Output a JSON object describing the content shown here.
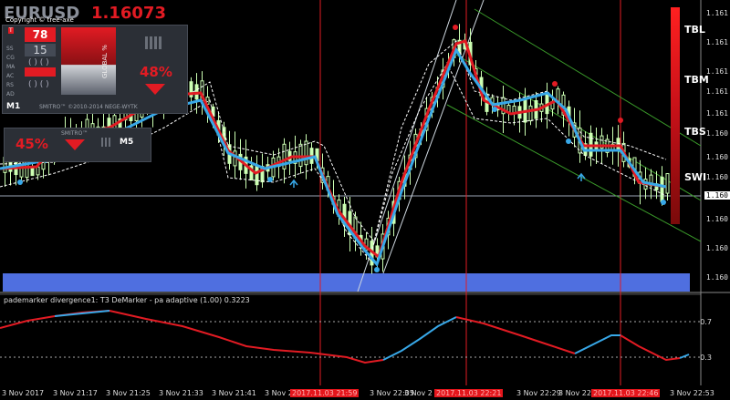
{
  "header": {
    "symbol": "EURUSD",
    "price": "1.16073",
    "copyright": "Copyright © tree-axe"
  },
  "panel": {
    "count": "78",
    "sub_count": "15",
    "timeframe_main": "M1",
    "timeframe_second": "M5",
    "pct_right": "48%",
    "pct_left": "45%",
    "global_label": "GLOBAL %",
    "credit": "SMITRO™ ©2010-2014 NEGE-WYTK",
    "side_labels": [
      "T",
      "SS",
      "CG",
      "MA",
      "AC",
      "RS",
      "AD"
    ]
  },
  "right_labels": [
    "TBL",
    "TBM",
    "TBS",
    "SWI"
  ],
  "price_axis": [
    "1.161",
    "1.161",
    "1.161",
    "1.161",
    "1.161",
    "1.160",
    "1.160",
    "1.160",
    "1.160",
    "1.160",
    "1.160"
  ],
  "price_current": "1.160",
  "indicator": {
    "title": "pademarker divergence1: T3 DeMarker - pa adaptive (1.00) 0.3223",
    "levels": [
      "0.7",
      "0.3"
    ]
  },
  "time_axis": [
    "3 Nov 2017",
    "3 Nov 21:17",
    "3 Nov 21:25",
    "3 Nov 21:33",
    "3 Nov 21:41",
    "3 Nov 21:49",
    "2017.11.03 21:59",
    "3 Nov 22:05",
    "3 Nov 2",
    "2017.11.03 22:21",
    "3 Nov 22:29",
    "3 Nov 22:37",
    "2017.11.03 22:46",
    "3 Nov 22:53"
  ],
  "colors": {
    "accent_red": "#e21b23",
    "blue_band": "#4f6fe0",
    "indicator_blue": "#38a8e8",
    "candle": "#ccffb3"
  }
}
